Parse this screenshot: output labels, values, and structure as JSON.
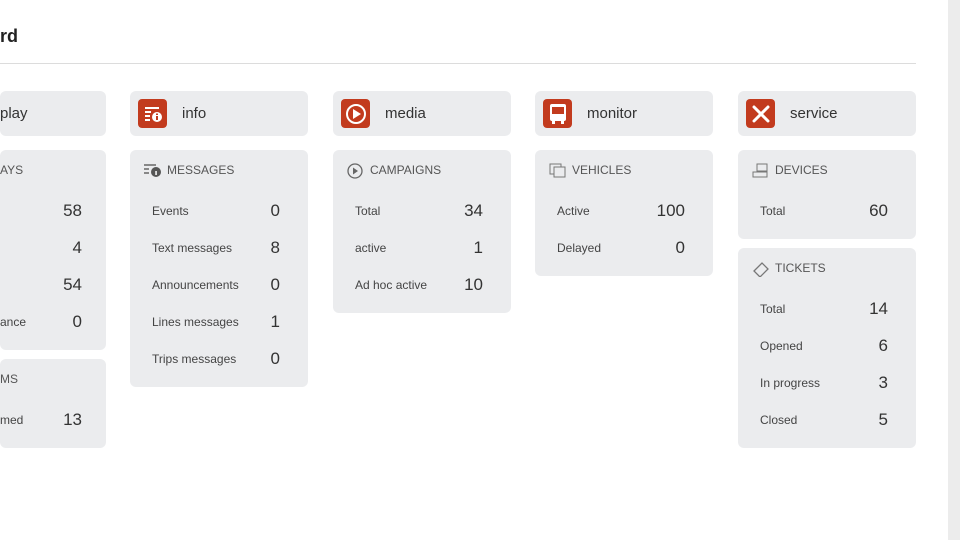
{
  "page": {
    "title": "rd"
  },
  "accent": "#c23b1e",
  "columns": [
    {
      "name": "play",
      "sections": [
        {
          "title": "AYS",
          "rows": [
            {
              "label": "",
              "value": "58"
            },
            {
              "label": "",
              "value": "4"
            },
            {
              "label": "",
              "value": "54"
            },
            {
              "label": "ance",
              "value": "0"
            }
          ]
        },
        {
          "title": "MS",
          "rows": [
            {
              "label": "med",
              "value": "13"
            }
          ]
        }
      ]
    },
    {
      "name": "info",
      "icon": "info-list-icon",
      "sections": [
        {
          "title": "MESSAGES",
          "icon": "messages-icon",
          "rows": [
            {
              "label": "Events",
              "value": "0"
            },
            {
              "label": "Text messages",
              "value": "8"
            },
            {
              "label": "Announcements",
              "value": "0"
            },
            {
              "label": "Lines messages",
              "value": "1"
            },
            {
              "label": "Trips messages",
              "value": "0"
            }
          ]
        }
      ]
    },
    {
      "name": "media",
      "icon": "play-circle-icon",
      "sections": [
        {
          "title": "CAMPAIGNS",
          "icon": "play-icon",
          "rows": [
            {
              "label": "Total",
              "value": "34"
            },
            {
              "label": "active",
              "value": "1"
            },
            {
              "label": "Ad hoc active",
              "value": "10"
            }
          ]
        }
      ]
    },
    {
      "name": "monitor",
      "icon": "bus-icon",
      "sections": [
        {
          "title": "VEHICLES",
          "icon": "vehicles-icon",
          "rows": [
            {
              "label": "Active",
              "value": "100"
            },
            {
              "label": "Delayed",
              "value": "0"
            }
          ]
        }
      ]
    },
    {
      "name": "service",
      "icon": "tools-icon",
      "sections": [
        {
          "title": "DEVICES",
          "icon": "devices-icon",
          "rows": [
            {
              "label": "Total",
              "value": "60"
            }
          ]
        },
        {
          "title": "TICKETS",
          "icon": "ticket-icon",
          "rows": [
            {
              "label": "Total",
              "value": "14"
            },
            {
              "label": "Opened",
              "value": "6"
            },
            {
              "label": "In progress",
              "value": "3"
            },
            {
              "label": "Closed",
              "value": "5"
            }
          ]
        }
      ]
    }
  ]
}
